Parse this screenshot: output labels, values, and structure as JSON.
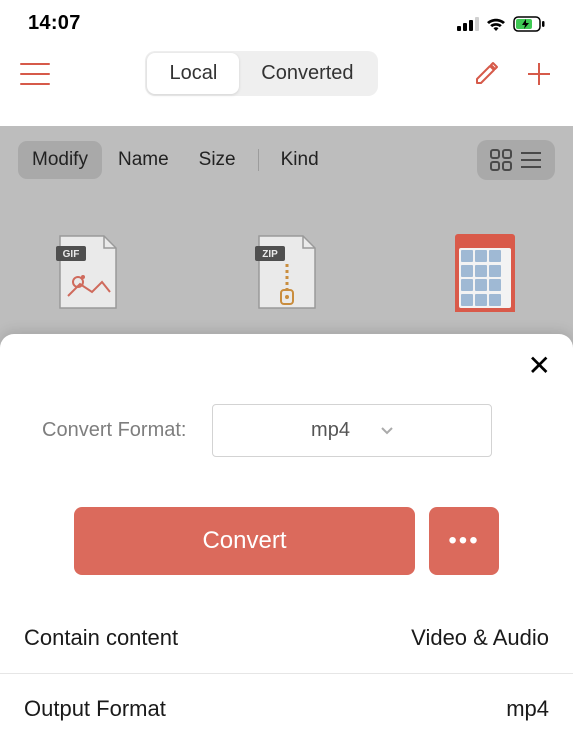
{
  "status": {
    "time": "14:07"
  },
  "tabs": {
    "local": "Local",
    "converted": "Converted",
    "active": "local"
  },
  "sort": {
    "modify": "Modify",
    "name": "Name",
    "size": "Size",
    "kind": "Kind",
    "selected": "modify"
  },
  "files": {
    "gif_badge": "GIF",
    "zip_badge": "ZIP"
  },
  "sheet": {
    "format_label": "Convert Format:",
    "selected_format": "mp4",
    "convert_button": "Convert",
    "more_button": "•••",
    "close": "✕",
    "rows": {
      "contain_label": "Contain content",
      "contain_value": "Video & Audio",
      "output_label": "Output Format",
      "output_value": "mp4"
    }
  },
  "colors": {
    "accent": "#db6a5c",
    "accent_dark": "#d65a4a"
  }
}
